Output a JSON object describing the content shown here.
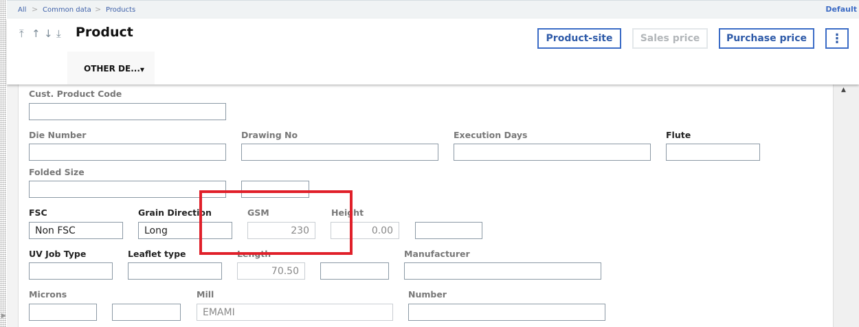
{
  "breadcrumb": [
    "All",
    "Common data",
    "Products"
  ],
  "view": "Default",
  "title": "Product",
  "tab": "OTHER DE...",
  "buttons": {
    "product_site": "Product-site",
    "sales_price": "Sales price",
    "purchase_price": "Purchase price",
    "more": "⋮"
  },
  "nav": {
    "first": "⤒",
    "prev": "↑",
    "next": "↓",
    "last": "⤓"
  },
  "fields": {
    "cust_product_code": {
      "label": "Cust. Product Code",
      "value": ""
    },
    "die_number": {
      "label": "Die Number",
      "value": ""
    },
    "drawing_no": {
      "label": "Drawing No",
      "value": ""
    },
    "execution_days": {
      "label": "Execution Days",
      "value": ""
    },
    "flute": {
      "label": "Flute",
      "value": ""
    },
    "folded_size": {
      "label": "Folded Size",
      "value": ""
    },
    "fsc": {
      "label": "FSC",
      "value": "Non FSC"
    },
    "grain_direction": {
      "label": "Grain Direction",
      "value": "Long"
    },
    "gsm": {
      "label": "GSM",
      "value": "230"
    },
    "height": {
      "label": "Height",
      "value": "0.00"
    },
    "uv_job_type": {
      "label": "UV Job Type",
      "value": ""
    },
    "leaflet_type": {
      "label": "Leaflet type",
      "value": ""
    },
    "length": {
      "label": "Length",
      "value": "70.50"
    },
    "manufacturer": {
      "label": "Manufacturer",
      "value": ""
    },
    "microns": {
      "label": "Microns",
      "value": ""
    },
    "mill": {
      "label": "Mill",
      "value": "EMAMI"
    },
    "number": {
      "label": "Number",
      "value": ""
    }
  },
  "highlight_color": "#e0202a"
}
